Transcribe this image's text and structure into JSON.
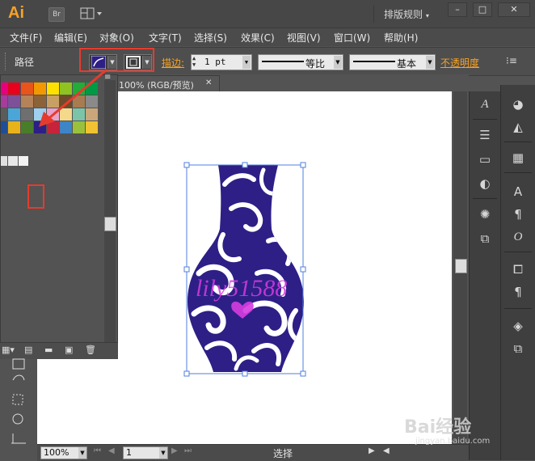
{
  "app": {
    "logo": "Ai",
    "bridge": "Br",
    "workspace": "排版规则",
    "win_min": "–",
    "win_max": "□",
    "win_close": "✕"
  },
  "menu": [
    "文件(F)",
    "编辑(E)",
    "对象(O)",
    "文字(T)",
    "选择(S)",
    "效果(C)",
    "视图(V)",
    "窗口(W)",
    "帮助(H)"
  ],
  "control": {
    "object_type": "路径",
    "stroke_label": "描边:",
    "stroke_weight": "1 pt",
    "profile_uniform": "等比",
    "profile_brush": "基本",
    "opacity_label": "不透明度"
  },
  "document": {
    "tab_title": "100% (RGB/预览)",
    "close": "✕"
  },
  "status": {
    "zoom": "100%",
    "page": "1",
    "tool": "选择"
  },
  "vase": {
    "fill_color": "#2d1f86",
    "watermark_text": "lily51588"
  },
  "watermark": {
    "brand": "Bai经验",
    "url": "jingyan.baidu.com"
  },
  "colors": {
    "accent": "#f7a224",
    "highlight": "#e53b2e",
    "selection": "#4f7fe0"
  }
}
